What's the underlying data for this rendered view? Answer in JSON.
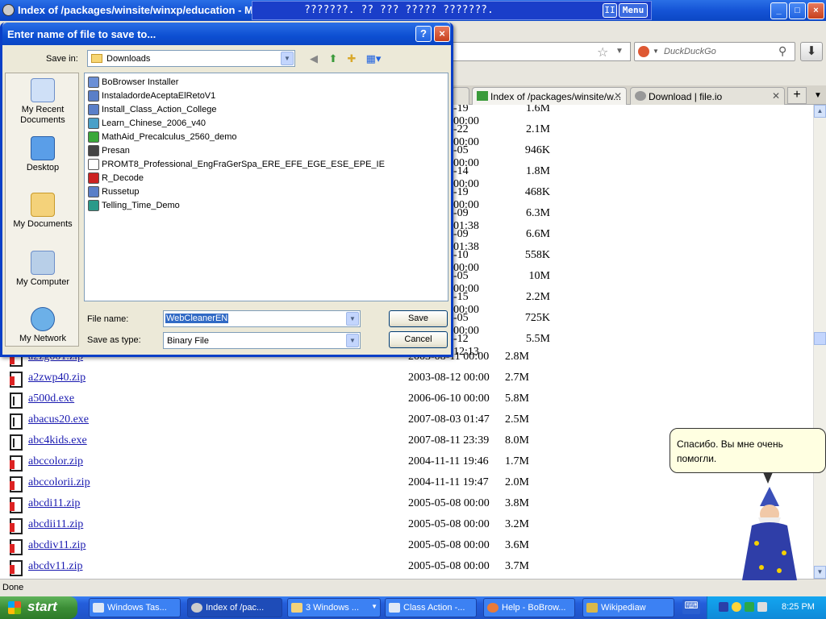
{
  "browser": {
    "title": "Index of /packages/winsite/winxp/education - M",
    "notification": "???????. ?? ??? ????? ???????.",
    "notification_menu": "Menu",
    "notification_pause": "II",
    "window_buttons": {
      "minimize": "_",
      "maximize": "□",
      "close": "×"
    },
    "search_placeholder": "DuckDuckGo",
    "tabs": [
      {
        "label": "",
        "active": false
      },
      {
        "label": "Index of /packages/winsite/w...",
        "active": true
      },
      {
        "label": "Download | file.io",
        "active": false
      }
    ],
    "new_tab": "+",
    "status": "Done"
  },
  "listing_partial": [
    {
      "date": "-19 00:00",
      "size": "1.6M"
    },
    {
      "date": "-22 00:00",
      "size": "2.1M"
    },
    {
      "date": "-05 00:00",
      "size": "946K"
    },
    {
      "date": "-14 00:00",
      "size": "1.8M"
    },
    {
      "date": "-19 00:00",
      "size": "468K"
    },
    {
      "date": "-09 01:38",
      "size": "6.3M"
    },
    {
      "date": "-09 01:38",
      "size": "6.6M"
    },
    {
      "date": "-10 00:00",
      "size": "558K"
    },
    {
      "date": "-05 00:00",
      "size": "10M"
    },
    {
      "date": "-15 00:00",
      "size": "2.2M"
    },
    {
      "date": "-05 00:00",
      "size": "725K"
    },
    {
      "date": "-12 12:13",
      "size": "5.5M"
    }
  ],
  "listing": [
    {
      "name": "a2zg001.zip",
      "date": "2003-08-11 00:00",
      "size": "2.8M",
      "icon": "zip"
    },
    {
      "name": "a2zwp40.zip",
      "date": "2003-08-12 00:00",
      "size": "2.7M",
      "icon": "zip"
    },
    {
      "name": "a500d.exe",
      "date": "2006-06-10 00:00",
      "size": "5.8M",
      "icon": "exe"
    },
    {
      "name": "abacus20.exe",
      "date": "2007-08-03 01:47",
      "size": "2.5M",
      "icon": "exe"
    },
    {
      "name": "abc4kids.exe",
      "date": "2007-08-11 23:39",
      "size": "8.0M",
      "icon": "exe"
    },
    {
      "name": "abccolor.zip",
      "date": "2004-11-11 19:46",
      "size": "1.7M",
      "icon": "zip"
    },
    {
      "name": "abccolorii.zip",
      "date": "2004-11-11 19:47",
      "size": "2.0M",
      "icon": "zip"
    },
    {
      "name": "abcdi11.zip",
      "date": "2005-05-08 00:00",
      "size": "3.8M",
      "icon": "zip"
    },
    {
      "name": "abcdii11.zip",
      "date": "2005-05-08 00:00",
      "size": "3.2M",
      "icon": "zip"
    },
    {
      "name": "abcdiv11.zip",
      "date": "2005-05-08 00:00",
      "size": "3.6M",
      "icon": "zip"
    },
    {
      "name": "abcdv11.zip",
      "date": "2005-05-08 00:00",
      "size": "3.7M",
      "icon": "zip"
    }
  ],
  "dialog": {
    "title": "Enter name of file to save to...",
    "help": "?",
    "close": "×",
    "save_in_label": "Save in:",
    "save_in_value": "Downloads",
    "places": [
      "My Recent Documents",
      "Desktop",
      "My Documents",
      "My Computer",
      "My Network"
    ],
    "files": [
      "BoBrowser Installer",
      "InstaladordeAceptaElRetoV1",
      "Install_Class_Action_College",
      "Learn_Chinese_2006_v40",
      "MathAid_Precalculus_2560_demo",
      "Presan",
      "PROMT8_Professional_EngFraGerSpa_ERE_EFE_EGE_ESE_EPE_IE",
      "R_Decode",
      "Russetup",
      "Telling_Time_Demo"
    ],
    "file_name_label": "File name:",
    "file_name_value": "WebCleanerEN",
    "save_type_label": "Save as type:",
    "save_type_value": "Binary File",
    "save_button": "Save",
    "cancel_button": "Cancel"
  },
  "assistant": {
    "bubble_text": "Спасибо. Вы мне очень помогли."
  },
  "taskbar": {
    "start": "start",
    "items": [
      {
        "label": "Windows Tas...",
        "active": false
      },
      {
        "label": "Index of /pac...",
        "active": true
      },
      {
        "label": "3 Windows ...",
        "active": false
      },
      {
        "label": "Class Action -...",
        "active": false
      },
      {
        "label": "Help - BoBrow...",
        "active": false
      },
      {
        "label": "Wikipediaw",
        "active": false
      }
    ],
    "clock": "8:25 PM"
  },
  "colors": {
    "xp_blue": "#0a45c4",
    "link": "#1a1ab0",
    "selection": "#316ac5"
  }
}
